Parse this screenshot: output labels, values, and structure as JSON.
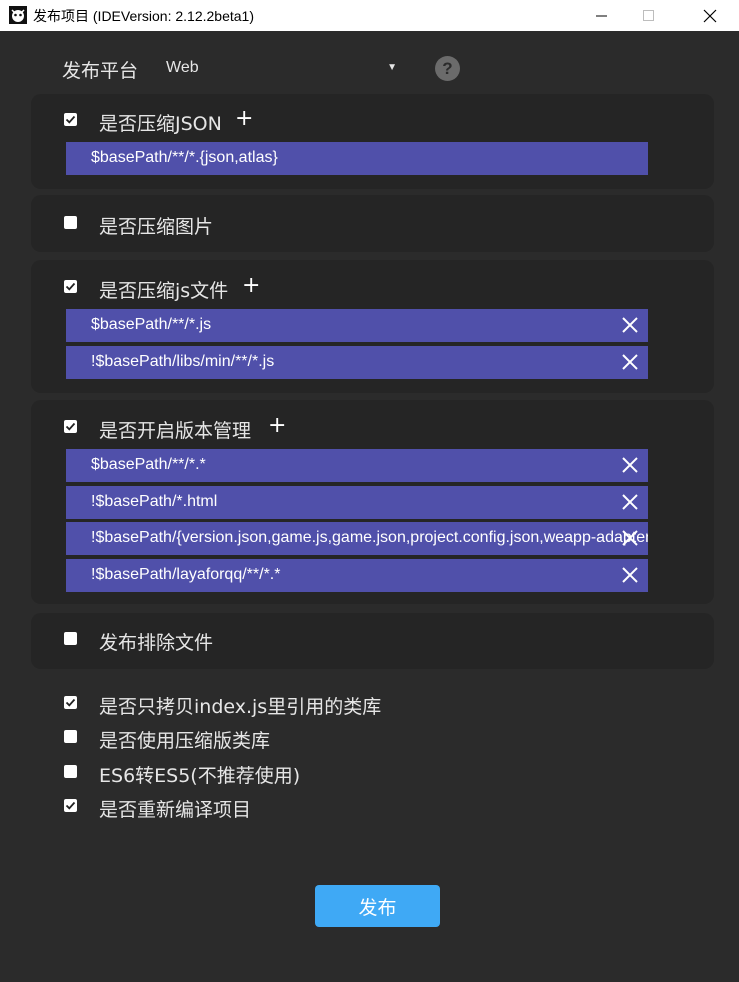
{
  "window": {
    "title": "发布项目 (IDEVersion: 2.12.2beta1)"
  },
  "platform": {
    "label": "发布平台",
    "selected": "Web"
  },
  "options": {
    "compress_json": {
      "label": "是否压缩JSON",
      "checked": true,
      "paths": [
        "$basePath/**/*.{json,atlas}"
      ]
    },
    "compress_images": {
      "label": "是否压缩图片",
      "checked": false
    },
    "compress_js": {
      "label": "是否压缩js文件",
      "checked": true,
      "paths": [
        "$basePath/**/*.js",
        "!$basePath/libs/min/**/*.js"
      ]
    },
    "version_control": {
      "label": "是否开启版本管理",
      "checked": true,
      "paths": [
        "$basePath/**/*.*",
        "!$basePath/*.html",
        "!$basePath/{version.json,game.js,game.json,project.config.json,weapp-adapter.js}",
        "!$basePath/layaforqq/**/*.*"
      ]
    },
    "exclude_files": {
      "label": "发布排除文件",
      "checked": false
    },
    "copy_referenced_libs": {
      "label": "是否只拷贝index.js里引用的类库",
      "checked": true
    },
    "use_min_libs": {
      "label": "是否使用压缩版类库",
      "checked": false
    },
    "es6_to_es5": {
      "label": "ES6转ES5(不推荐使用)",
      "checked": false
    },
    "recompile": {
      "label": "是否重新编译项目",
      "checked": true
    }
  },
  "publish_button": {
    "label": "发布"
  },
  "colors": {
    "background": "#2b2b2b",
    "panel": "#252525",
    "path_row": "#5050aa",
    "publish": "#3fa9f5"
  }
}
